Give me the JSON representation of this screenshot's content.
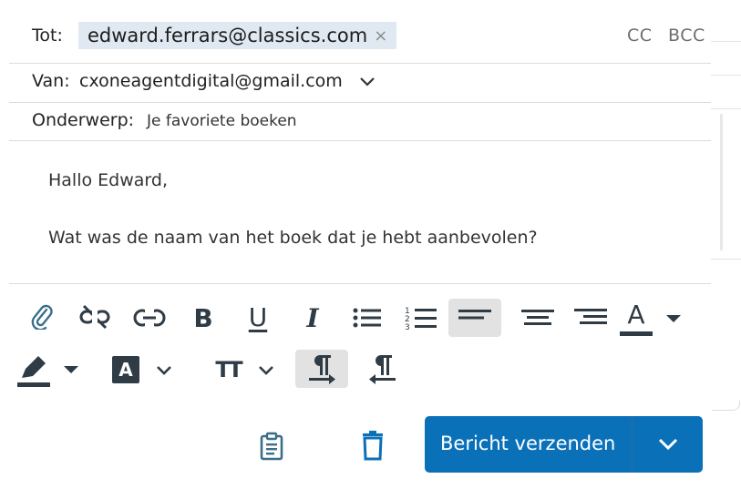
{
  "to": {
    "label": "Tot:",
    "recipient": "edward.ferrars@classics.com",
    "remove": "×",
    "cc": "CC",
    "bcc": "BCC"
  },
  "from": {
    "label": "Van:",
    "value": "cxoneagentdigital@gmail.com"
  },
  "subject": {
    "label": "Onderwerp:",
    "value": "Je favoriete boeken"
  },
  "body": {
    "greeting": "Hallo Edward,",
    "line": "Wat was de naam van het boek dat je hebt aanbevolen?"
  },
  "toolbar": {
    "icons": [
      "paperclip-icon",
      "unlink-icon",
      "link-icon",
      "bold-icon",
      "underline-icon",
      "italic-icon",
      "bullet-list-icon",
      "numbered-list-icon",
      "align-left-icon",
      "align-center-icon",
      "align-right-icon",
      "font-color-icon",
      "highlight-icon",
      "text-background-icon",
      "font-size-icon",
      "ltr-icon",
      "rtl-icon"
    ],
    "selected": [
      "align-left",
      "ltr"
    ],
    "bold": "B",
    "underline": "U",
    "italic": "I",
    "font_color_letter": "A",
    "text_bg_letter": "A",
    "font_size": "TT"
  },
  "send": {
    "label": "Bericht verzenden"
  },
  "colors": {
    "accent": "#0a71b9",
    "chip": "#e0e9f2",
    "icon": "#2f3b45",
    "icon_blue": "#0a71b9",
    "icon_teal": "#3a6f8a"
  }
}
